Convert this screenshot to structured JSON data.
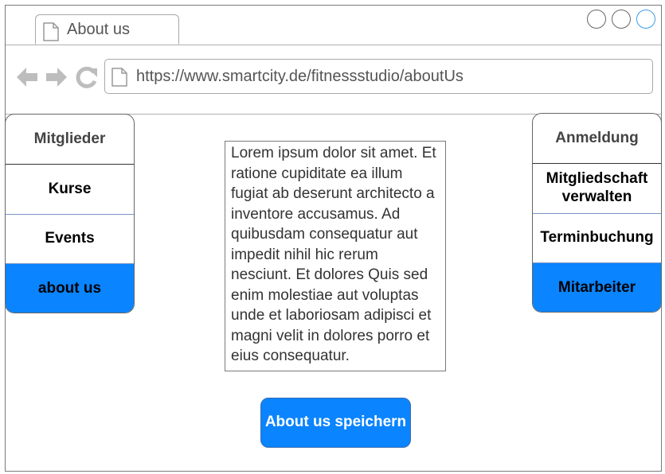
{
  "browser": {
    "tab_title": "About us",
    "url": "https://www.smartcity.de/fitnessstudio/aboutUs"
  },
  "left_menu": {
    "header": "Mitglieder",
    "items": [
      "Kurse",
      "Events",
      "about us"
    ],
    "active_item": "about us"
  },
  "right_menu": {
    "header": "Anmeldung",
    "items": [
      "Mitgliedschaft verwalten",
      "Terminbuchung",
      "Mitarbeiter"
    ],
    "active_item": "Mitarbeiter"
  },
  "content": {
    "text": "Lorem ipsum dolor sit amet. Et ratione cupiditate ea illum fugiat ab deserunt architecto a inventore accusamus. Ad quibusdam consequatur aut impedit nihil hic rerum nesciunt. Et dolores Quis sed enim molestiae aut voluptas unde et laboriosam adipisci et magni velit in dolores porro et eius consequatur."
  },
  "actions": {
    "save_label": "About us speichern"
  },
  "colors": {
    "accent": "#0a84ff",
    "window_control_highlight": "#3b9be8"
  }
}
